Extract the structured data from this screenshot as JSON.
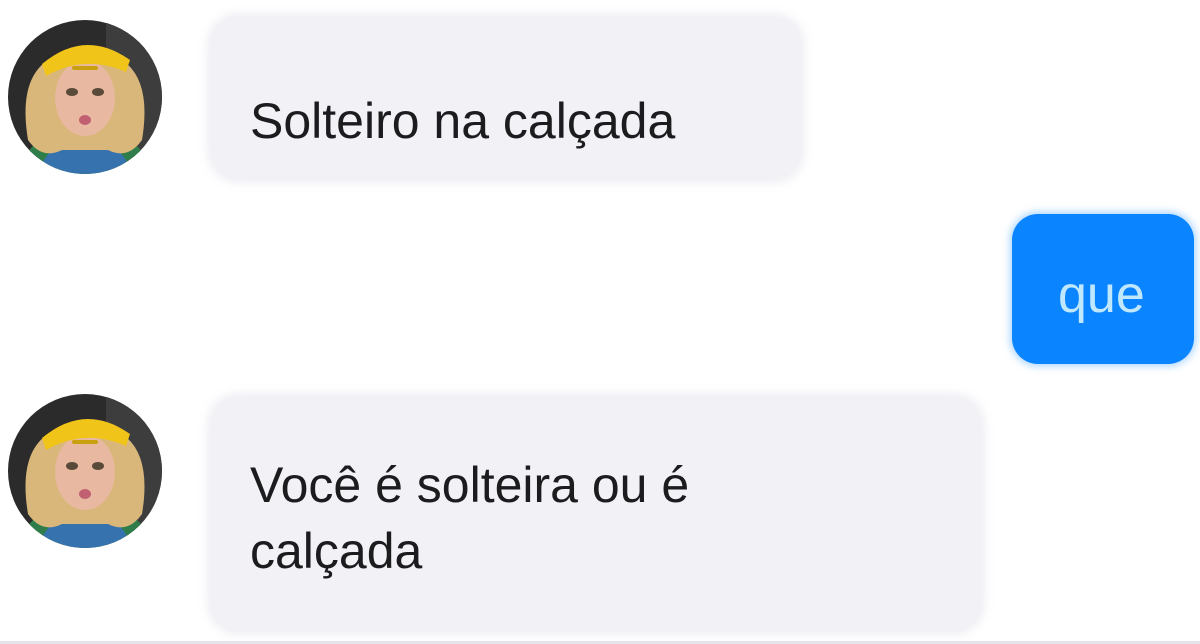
{
  "messages": [
    {
      "direction": "incoming",
      "text": "Solteiro na calçada",
      "has_avatar": true
    },
    {
      "direction": "outgoing",
      "text": "que",
      "has_avatar": false
    },
    {
      "direction": "incoming",
      "text": "Você é solteira ou é calçada",
      "has_avatar": true
    }
  ],
  "colors": {
    "incoming_bubble": "#f1f1f6",
    "outgoing_bubble": "#0a84ff",
    "outgoing_text": "#bfe8ff",
    "incoming_text": "#1c1c1e",
    "avatar_cap": "#f0c419"
  },
  "icons": {
    "avatar": "contact-avatar-photo"
  }
}
